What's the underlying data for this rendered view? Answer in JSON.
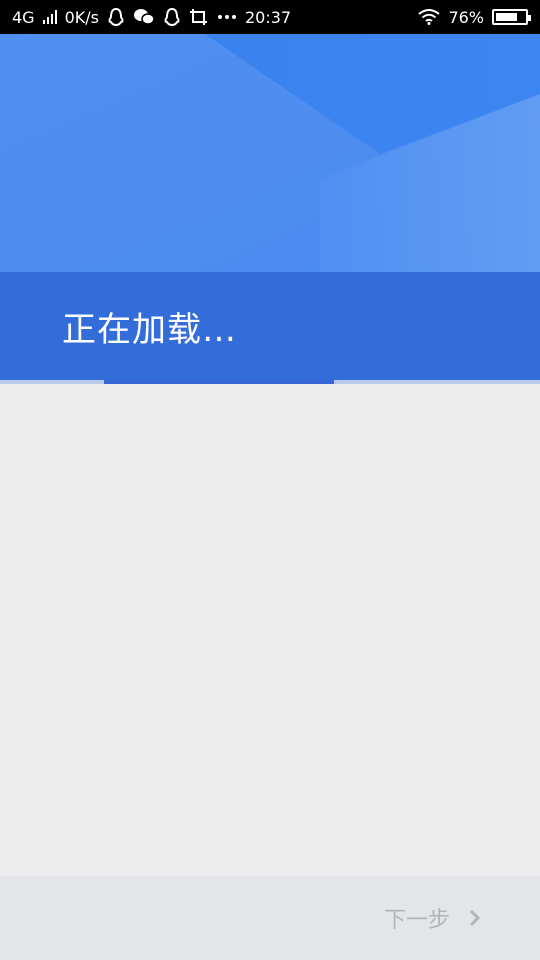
{
  "status_bar": {
    "network": "4G",
    "speed": "0K/s",
    "time": "20:37",
    "battery": "76%",
    "battery_level": 0.76,
    "icons": [
      "qq-icon",
      "wechat-icon",
      "qq-icon",
      "screenshot-icon",
      "more-icon",
      "wifi-icon",
      "battery-icon"
    ]
  },
  "loading": {
    "text": "正在加载…"
  },
  "footer": {
    "next_label": "下一步"
  },
  "colors": {
    "hero_blue": "#3b84f0",
    "band_blue": "#336dd9",
    "progress": "#3568d6"
  }
}
